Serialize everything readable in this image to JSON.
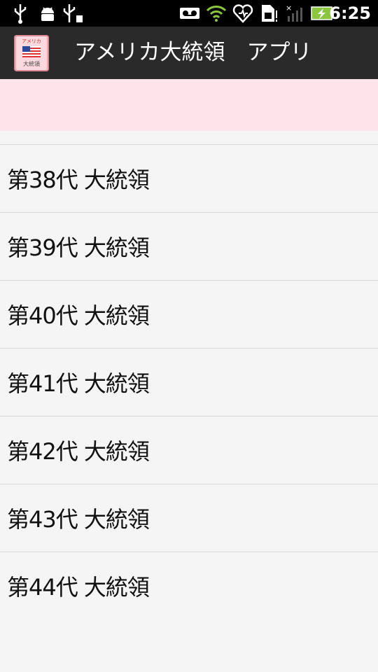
{
  "status_bar": {
    "time": "6:25",
    "icons": [
      "usb-icon",
      "android-debug-icon",
      "usb-storage-icon",
      "voicemail-icon",
      "wifi-icon",
      "heart-icon",
      "sim-card-icon",
      "signal-icon",
      "battery-charging-icon"
    ]
  },
  "action_bar": {
    "title": "アメリカ大統領　アプリ",
    "icon": "app-book-icon",
    "icon_text_top": "アメリカ",
    "icon_text_bottom": "大統領"
  },
  "colors": {
    "status_bar": "#000000",
    "action_bar": "#2a2a2a",
    "ad_banner": "#ffe4ec",
    "background": "#f5f5f5",
    "battery": "#8cc63f"
  },
  "list": {
    "items": [
      {
        "label": "第38代 大統領"
      },
      {
        "label": "第39代 大統領"
      },
      {
        "label": "第40代 大統領"
      },
      {
        "label": "第41代 大統領"
      },
      {
        "label": "第42代 大統領"
      },
      {
        "label": "第43代 大統領"
      },
      {
        "label": "第44代 大統領"
      }
    ]
  }
}
